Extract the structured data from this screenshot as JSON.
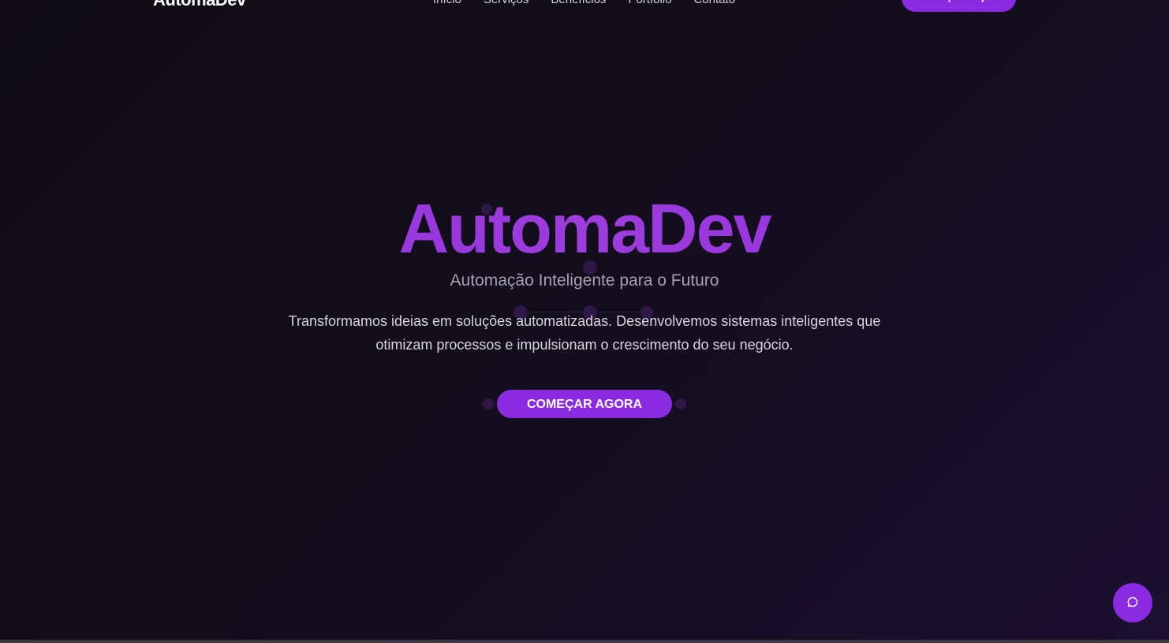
{
  "header": {
    "logo": "AutomaDev",
    "nav": [
      "Início",
      "Serviços",
      "Benefícios",
      "Portfólio",
      "Contato"
    ],
    "cta_label": "Começar Projeto"
  },
  "hero": {
    "title": "AutomaDev",
    "subtitle": "Automação Inteligente para o Futuro",
    "description": "Transformamos ideias em soluções automatizadas. Desenvolvemos sistemas inteligentes que otimizam processos e impulsionam o crescimento do seu negócio.",
    "cta_label": "COMEÇAR AGORA"
  },
  "chat": {
    "icon": "chat-bubble-icon"
  },
  "colors": {
    "accent": "#8a2be2",
    "background": "#120e1a"
  }
}
